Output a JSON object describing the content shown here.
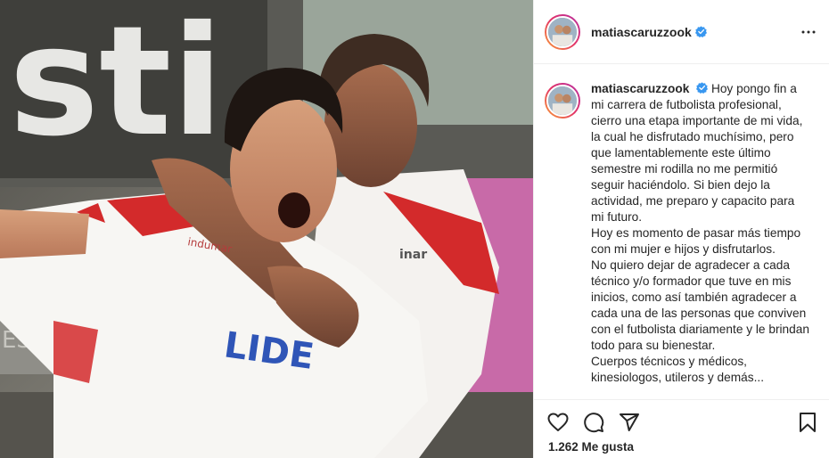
{
  "header": {
    "username": "matiascaruzzook",
    "verified_icon": "verified-badge-icon",
    "more_icon": "more-options-icon"
  },
  "photo": {
    "jersey_sponsor": "LIDE",
    "sleeve_brand": "inar",
    "chest_text": "indumar",
    "background_sign_letters": "sti",
    "background_ad_text": "ESPORTES"
  },
  "caption": {
    "username": "matiascaruzzook",
    "paragraphs": [
      "Hoy pongo fin a mi carrera de futbolista profesional, cierro una etapa importante de mi vida, la cual he disfrutado muchísimo, pero que lamentablemente este último semestre mi rodilla no me permitió seguir haciéndolo. Si bien dejo la actividad, me preparo y capacito para mi futuro.",
      "Hoy es momento de pasar más tiempo con mi mujer e hijos y disfrutarlos.",
      "No quiero dejar de agradecer a cada técnico y/o formador que tuve en mis inicios, como así también agradecer a cada una de las personas que conviven con el futbolista diariamente y le brindan todo para su bienestar.",
      "Cuerpos técnicos y médicos, kinesiologos, utileros y demás..."
    ]
  },
  "actions": {
    "like_icon": "heart-icon",
    "comment_icon": "comment-icon",
    "share_icon": "share-icon",
    "save_icon": "bookmark-icon"
  },
  "likes": {
    "text": "1.262 Me gusta"
  },
  "colors": {
    "verified": "#3897f0",
    "border": "#efefef",
    "text": "#262626",
    "jersey_red": "#d32a2b"
  }
}
